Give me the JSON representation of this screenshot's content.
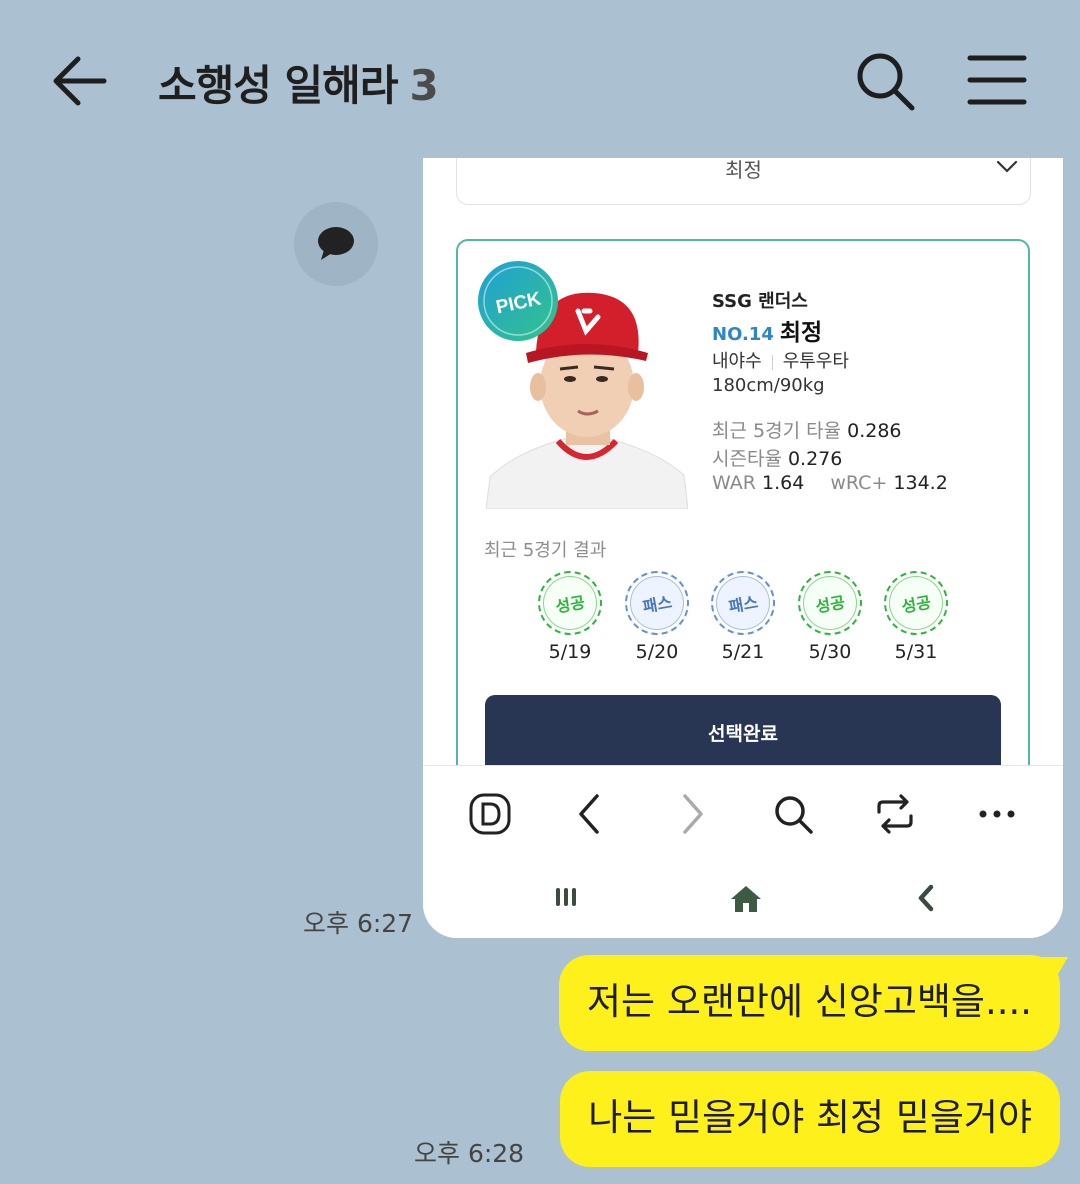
{
  "header": {
    "title": "소행성 일해라",
    "member_count": "3"
  },
  "shared_screenshot": {
    "dropdown_value": "최정",
    "player": {
      "badge": "PICK",
      "team": "SSG 랜더스",
      "number": "NO.14",
      "name": "최정",
      "position": "내야수",
      "bats_throws": "우투우타",
      "body": "180cm/90kg",
      "stats": {
        "recent5_label": "최근 5경기 타율",
        "recent5_value": "0.286",
        "season_label": "시즌타율",
        "season_value": "0.276",
        "war_label": "WAR",
        "war_value": "1.64",
        "wrc_label": "wRC+",
        "wrc_value": "134.2"
      }
    },
    "results_label": "최근 5경기 결과",
    "results": [
      {
        "label": "성공",
        "date": "5/19",
        "kind": "success"
      },
      {
        "label": "패스",
        "date": "5/20",
        "kind": "pass"
      },
      {
        "label": "패스",
        "date": "5/21",
        "kind": "pass"
      },
      {
        "label": "성공",
        "date": "5/30",
        "kind": "success"
      },
      {
        "label": "성공",
        "date": "5/31",
        "kind": "success"
      }
    ],
    "confirm_label": "선택완료",
    "browser_icons": [
      "d-icon",
      "back-icon",
      "forward-icon",
      "search-icon",
      "tabs-icon",
      "more-icon"
    ],
    "nav_icons": [
      "recents-icon",
      "home-icon",
      "nav-back-icon"
    ]
  },
  "messages": [
    {
      "time": "오후 6:27"
    },
    {
      "text": "저는 오랜만에 신앙고백을....",
      "time": ""
    },
    {
      "text": "나는 믿을거야 최정 믿을거야",
      "time": "오후 6:28"
    }
  ],
  "colors": {
    "background": "#abc1d1",
    "bubble": "#fef01b",
    "confirm_button": "#293653",
    "card_border": "#51b99f",
    "number_accent": "#2f86c5"
  }
}
